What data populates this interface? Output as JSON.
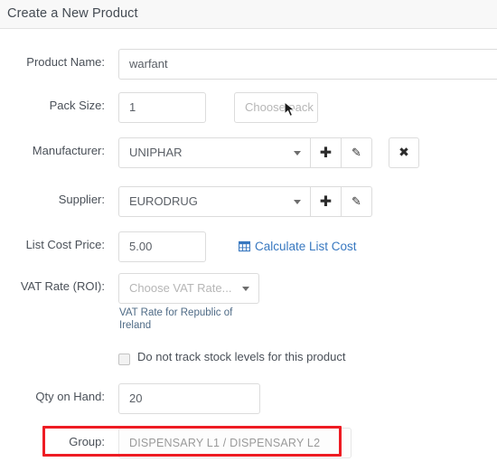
{
  "header": {
    "title": "Create a New Product"
  },
  "form": {
    "product_name": {
      "label": "Product Name:",
      "value": "warfant",
      "placeholder": ""
    },
    "pack_size": {
      "label": "Pack Size:",
      "value": "1"
    },
    "pack_unit": {
      "placeholder": "Choose pack unit..."
    },
    "manufacturer": {
      "label": "Manufacturer:",
      "value": "UNIPHAR",
      "add_icon": "plus-icon",
      "edit_icon": "pencil-icon",
      "clear_icon": "close-icon"
    },
    "supplier": {
      "label": "Supplier:",
      "value": "EURODRUG",
      "add_icon": "plus-icon",
      "edit_icon": "pencil-icon"
    },
    "list_cost_price": {
      "label": "List Cost Price:",
      "value": "5.00",
      "calc_link": "Calculate List Cost",
      "calc_icon": "grid-table-icon"
    },
    "vat_rate": {
      "label": "VAT Rate (ROI):",
      "placeholder": "Choose VAT Rate...",
      "help": "VAT Rate for Republic of Ireland"
    },
    "track_stock": {
      "label": "Do not track stock levels for this product",
      "checked": false
    },
    "qty_on_hand": {
      "label": "Qty on Hand:",
      "value": "20"
    },
    "group": {
      "label": "Group:",
      "value": "DISPENSARY L1  /  DISPENSARY L2"
    }
  },
  "glyphs": {
    "plus": "✚",
    "pencil": "✎",
    "close": "✖"
  },
  "colors": {
    "link": "#3878c0",
    "highlight": "#ee1c23",
    "header_bg": "#f8f8f8",
    "border": "#dcdcdc",
    "label_text": "#4a5058",
    "placeholder_text": "#b6b6b6"
  }
}
